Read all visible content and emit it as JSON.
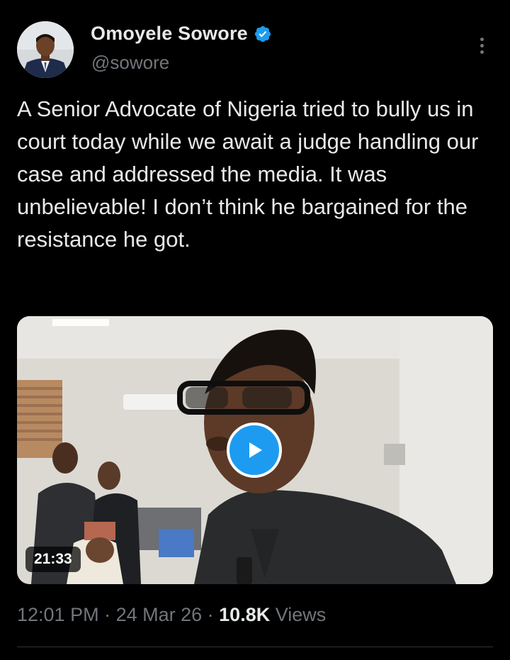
{
  "author": {
    "display_name": "Omoyele Sowore",
    "handle": "@sowore",
    "verified_icon": "verified-badge-icon",
    "avatar_icon": "profile-photo"
  },
  "tweet": {
    "text": "A Senior Advocate of Nigeria tried to bully us in court today while we await a judge handling our case and addressed the media. It was unbelievable! I don’t think he bargained for the resistance he got."
  },
  "media": {
    "type": "video",
    "duration": "21:33",
    "play_icon": "play-icon"
  },
  "meta": {
    "time": "12:01 PM",
    "separator": " · ",
    "date": "24 Mar 26",
    "views_count": "10.8K",
    "views_label": " Views"
  },
  "colors": {
    "background": "#000000",
    "text_primary": "#e7e9ea",
    "text_secondary": "#71767b",
    "accent": "#1d9bf0",
    "divider": "#2f3336"
  }
}
